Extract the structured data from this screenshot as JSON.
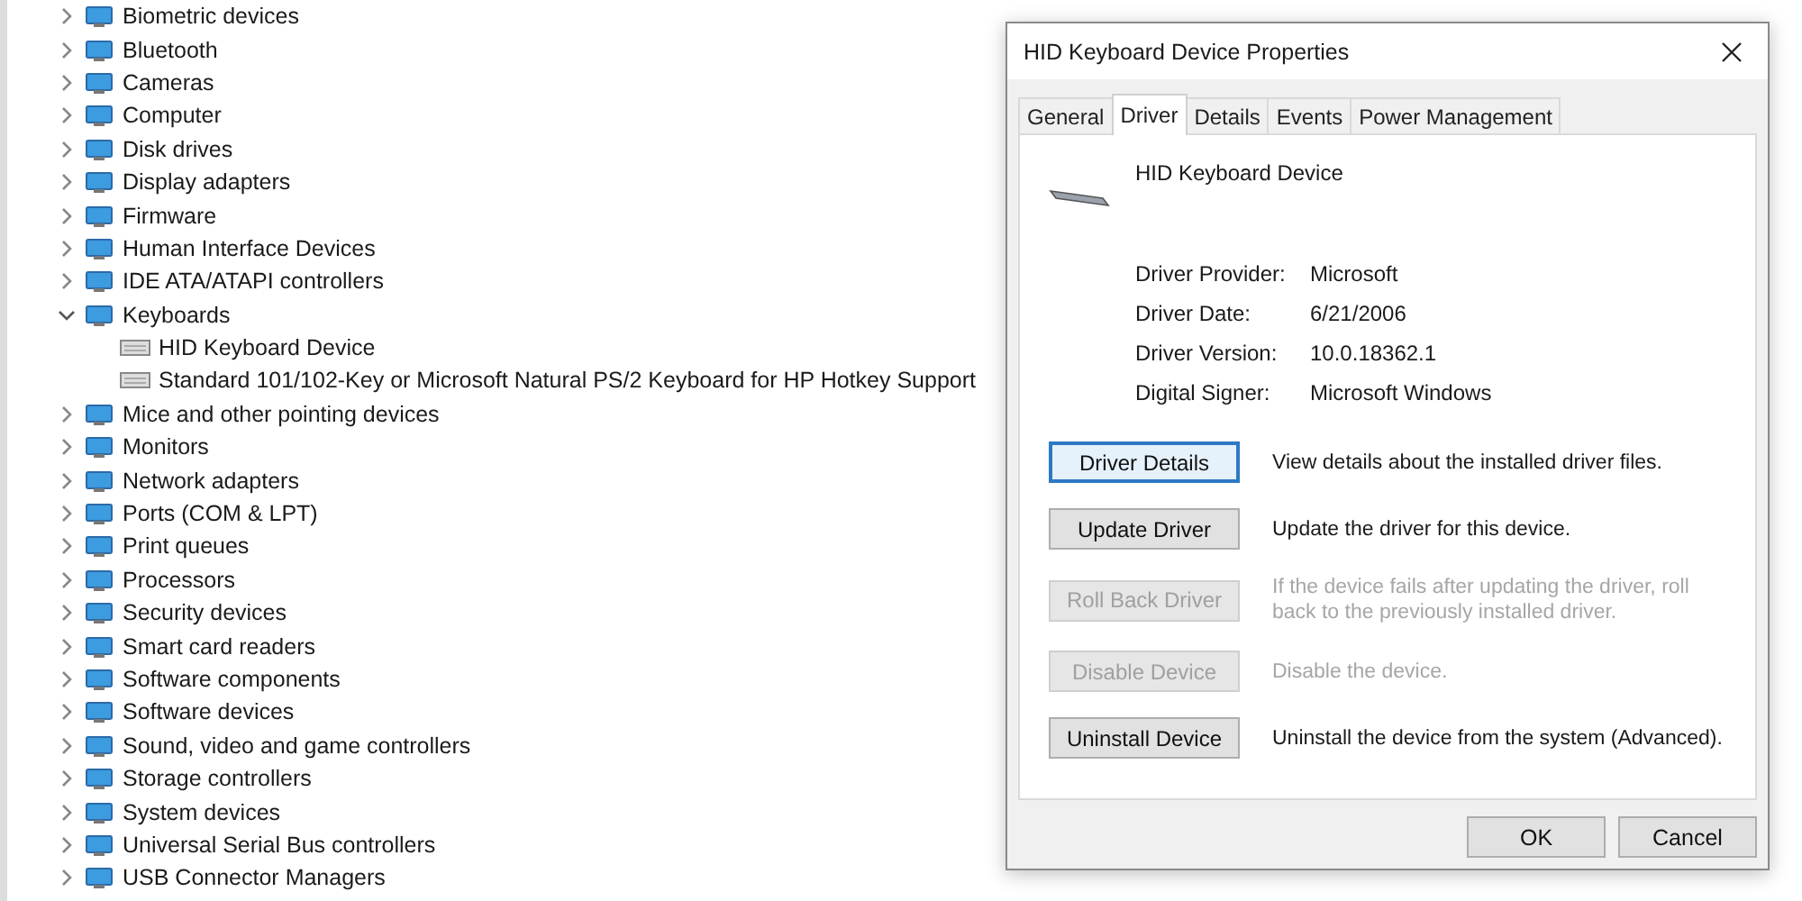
{
  "device_tree": [
    {
      "label": "Biometric devices",
      "expanded": false
    },
    {
      "label": "Bluetooth",
      "expanded": false
    },
    {
      "label": "Cameras",
      "expanded": false
    },
    {
      "label": "Computer",
      "expanded": false
    },
    {
      "label": "Disk drives",
      "expanded": false
    },
    {
      "label": "Display adapters",
      "expanded": false
    },
    {
      "label": "Firmware",
      "expanded": false
    },
    {
      "label": "Human Interface Devices",
      "expanded": false
    },
    {
      "label": "IDE ATA/ATAPI controllers",
      "expanded": false
    },
    {
      "label": "Keyboards",
      "expanded": true,
      "children": [
        {
          "label": "HID Keyboard Device"
        },
        {
          "label": "Standard 101/102-Key or Microsoft Natural PS/2 Keyboard for HP Hotkey Support"
        }
      ]
    },
    {
      "label": "Mice and other pointing devices",
      "expanded": false
    },
    {
      "label": "Monitors",
      "expanded": false
    },
    {
      "label": "Network adapters",
      "expanded": false
    },
    {
      "label": "Ports (COM & LPT)",
      "expanded": false
    },
    {
      "label": "Print queues",
      "expanded": false
    },
    {
      "label": "Processors",
      "expanded": false
    },
    {
      "label": "Security devices",
      "expanded": false
    },
    {
      "label": "Smart card readers",
      "expanded": false
    },
    {
      "label": "Software components",
      "expanded": false
    },
    {
      "label": "Software devices",
      "expanded": false
    },
    {
      "label": "Sound, video and game controllers",
      "expanded": false
    },
    {
      "label": "Storage controllers",
      "expanded": false
    },
    {
      "label": "System devices",
      "expanded": false
    },
    {
      "label": "Universal Serial Bus controllers",
      "expanded": false
    },
    {
      "label": "USB Connector Managers",
      "expanded": false
    }
  ],
  "dialog": {
    "title": "HID Keyboard Device Properties",
    "tabs": [
      {
        "label": "General",
        "selected": false
      },
      {
        "label": "Driver",
        "selected": true
      },
      {
        "label": "Details",
        "selected": false
      },
      {
        "label": "Events",
        "selected": false
      },
      {
        "label": "Power Management",
        "selected": false
      }
    ],
    "device_name": "HID Keyboard Device",
    "info": [
      {
        "label": "Driver Provider:",
        "value": "Microsoft"
      },
      {
        "label": "Driver Date:",
        "value": "6/21/2006"
      },
      {
        "label": "Driver Version:",
        "value": "10.0.18362.1"
      },
      {
        "label": "Digital Signer:",
        "value": "Microsoft Windows"
      }
    ],
    "actions": [
      {
        "button": "Driver Details",
        "description": "View details about the installed driver files.",
        "disabled": false,
        "focused": true
      },
      {
        "button": "Update Driver",
        "description": "Update the driver for this device.",
        "disabled": false,
        "focused": false
      },
      {
        "button": "Roll Back Driver",
        "description": "If the device fails after updating the driver, roll back to the previously installed driver.",
        "disabled": true,
        "focused": false
      },
      {
        "button": "Disable Device",
        "description": "Disable the device.",
        "disabled": true,
        "focused": false
      },
      {
        "button": "Uninstall Device",
        "description": "Uninstall the device from the system (Advanced).",
        "disabled": false,
        "focused": false
      }
    ],
    "footer_buttons": [
      "OK",
      "Cancel"
    ]
  }
}
